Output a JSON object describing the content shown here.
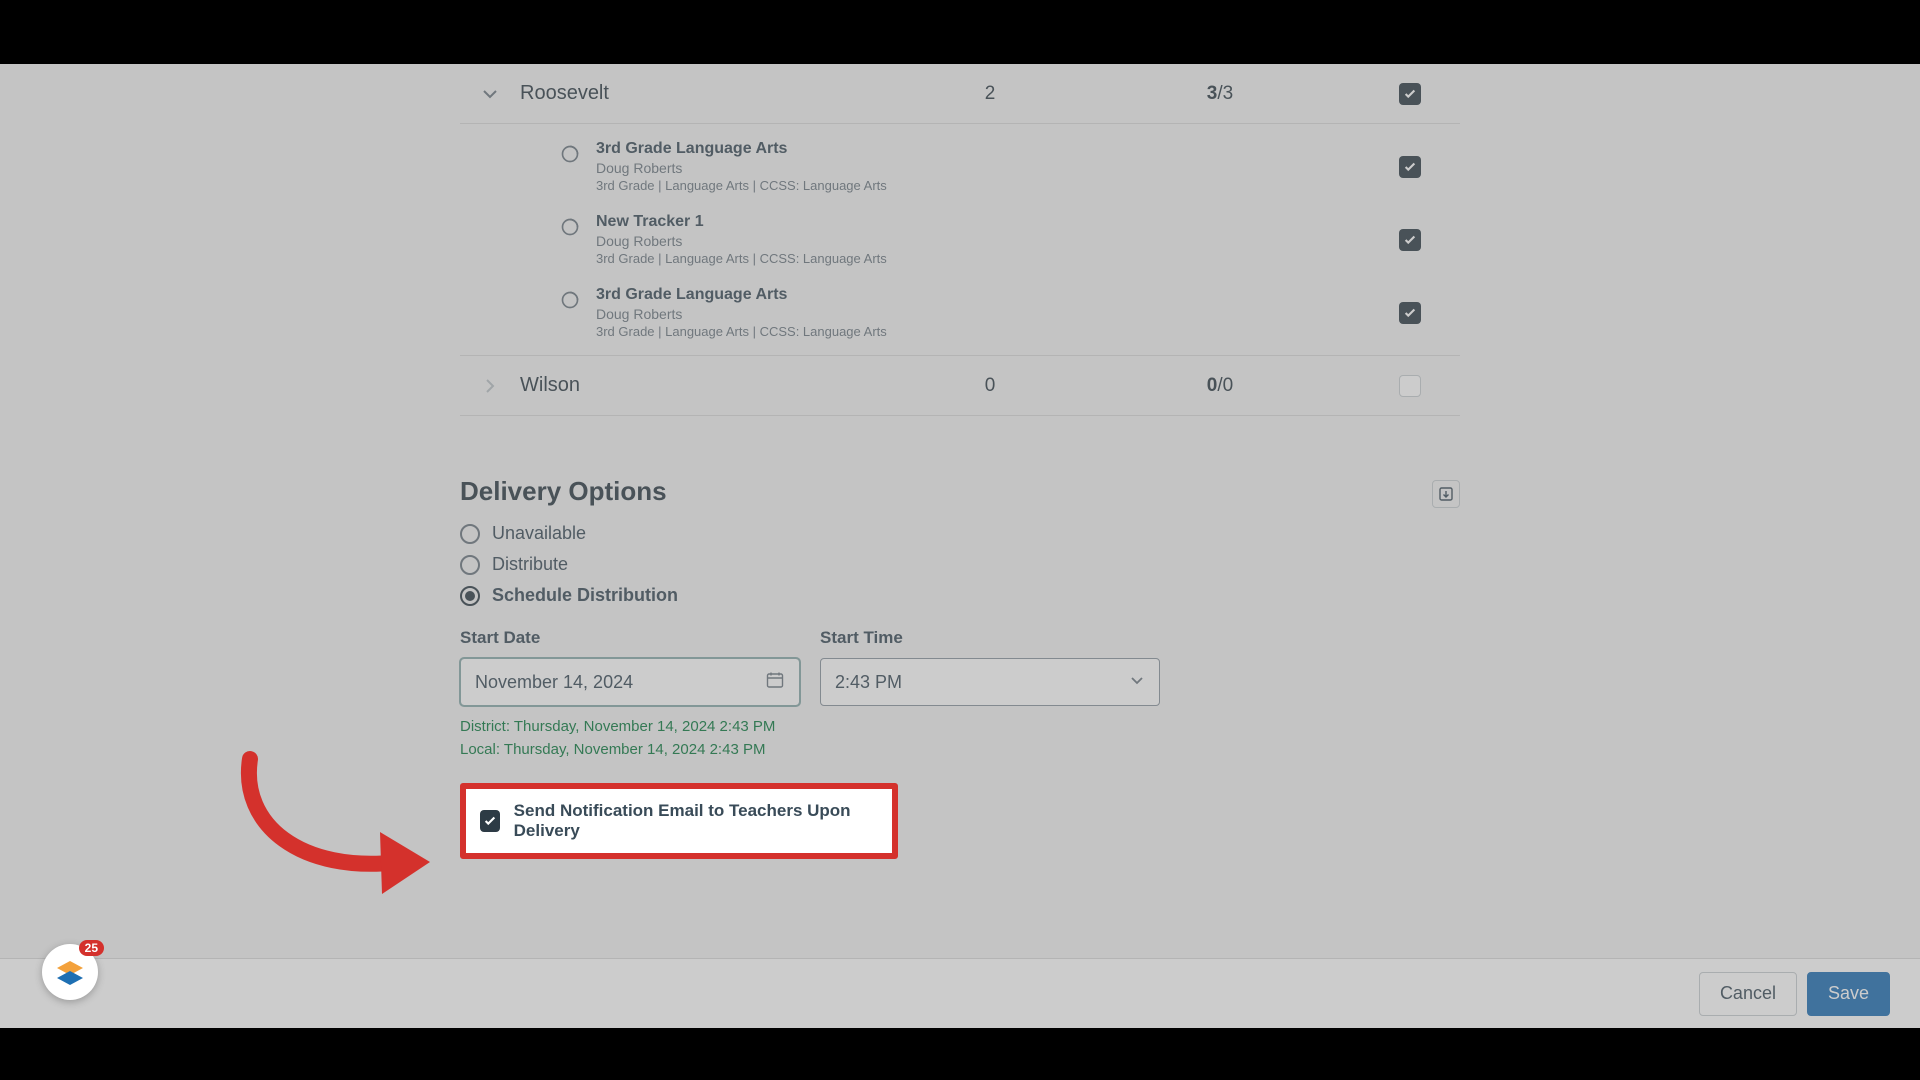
{
  "schools": [
    {
      "name": "Roosevelt",
      "count": "2",
      "selected": "3",
      "total": "3",
      "checked": true,
      "expanded": true,
      "classes": [
        {
          "title": "3rd Grade Language Arts",
          "teacher": "Doug Roberts",
          "meta": "3rd Grade  |  Language Arts  |  CCSS: Language Arts",
          "checked": true
        },
        {
          "title": "New Tracker 1",
          "teacher": "Doug Roberts",
          "meta": "3rd Grade  |  Language Arts  |  CCSS: Language Arts",
          "checked": true
        },
        {
          "title": "3rd Grade Language Arts",
          "teacher": "Doug Roberts",
          "meta": "3rd Grade  |  Language Arts  |  CCSS: Language Arts",
          "checked": true
        }
      ]
    },
    {
      "name": "Wilson",
      "count": "0",
      "selected": "0",
      "total": "0",
      "checked": false,
      "expanded": false,
      "classes": []
    }
  ],
  "delivery": {
    "heading": "Delivery Options",
    "options": {
      "unavailable": "Unavailable",
      "distribute": "Distribute",
      "schedule": "Schedule Distribution"
    },
    "selected": "schedule",
    "start_date_label": "Start Date",
    "start_time_label": "Start Time",
    "start_date_value": "November 14, 2024",
    "start_time_value": "2:43 PM",
    "district_hint": "District: Thursday, November 14, 2024 2:43 PM",
    "local_hint": "Local: Thursday, November 14, 2024 2:43 PM",
    "notify_label": "Send Notification Email to Teachers Upon Delivery",
    "notify_checked": true
  },
  "footer": {
    "cancel": "Cancel",
    "save": "Save"
  },
  "badge_count": "25"
}
